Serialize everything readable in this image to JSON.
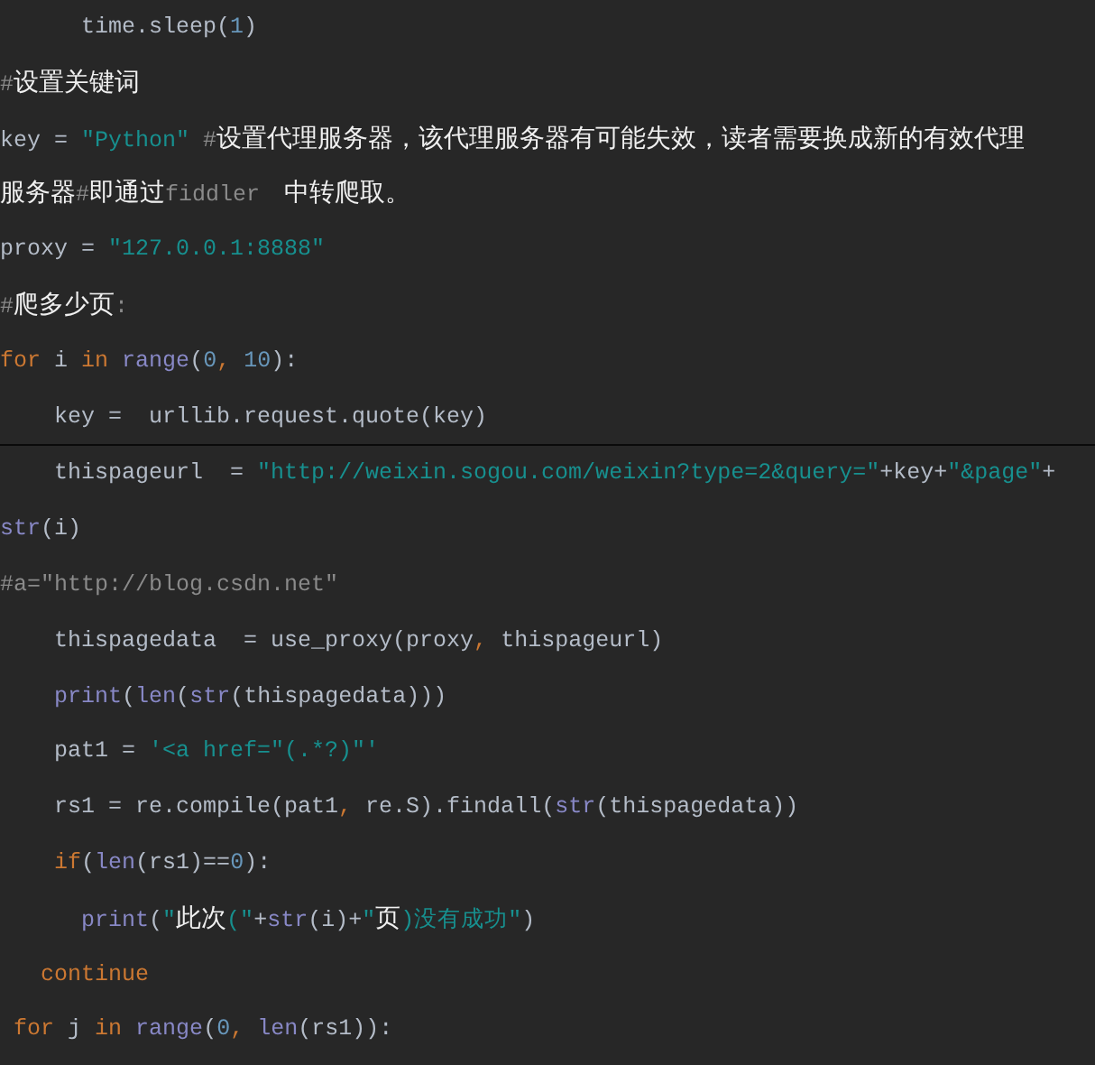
{
  "code_blocks": [
    {
      "lines": [
        {
          "tokens": [
            {
              "kind": "plain",
              "text": "      time.sleep("
            },
            {
              "kind": "number",
              "text": "1"
            },
            {
              "kind": "plain",
              "text": ")"
            }
          ]
        },
        {
          "tokens": [
            {
              "kind": "comment",
              "text": "#"
            },
            {
              "kind": "cjk",
              "text": "设置关键词"
            }
          ]
        },
        {
          "tokens": [
            {
              "kind": "plain",
              "text": "key = "
            },
            {
              "kind": "string",
              "text": "\"Python\" "
            },
            {
              "kind": "comment",
              "text": "#"
            },
            {
              "kind": "cjk",
              "text": "设置代理服务器，该代理服务器有可能失效，读者需要换成新的有效代理"
            }
          ]
        },
        {
          "tokens": [
            {
              "kind": "cjk",
              "text": "服务器"
            },
            {
              "kind": "comment",
              "text": "#"
            },
            {
              "kind": "cjk",
              "text": "即通过"
            },
            {
              "kind": "comment",
              "text": "fiddler"
            },
            {
              "kind": "cjk",
              "text": "   中转爬取。"
            }
          ]
        },
        {
          "tokens": [
            {
              "kind": "plain",
              "text": "proxy = "
            },
            {
              "kind": "string",
              "text": "\"127.0.0.1:8888\""
            }
          ]
        },
        {
          "tokens": [
            {
              "kind": "comment",
              "text": "#"
            },
            {
              "kind": "cjk",
              "text": "爬多少页"
            },
            {
              "kind": "comment",
              "text": ":"
            }
          ]
        },
        {
          "tokens": [
            {
              "kind": "keyword",
              "text": "for"
            },
            {
              "kind": "plain",
              "text": " i "
            },
            {
              "kind": "keyword",
              "text": "in "
            },
            {
              "kind": "builtin",
              "text": "range"
            },
            {
              "kind": "plain",
              "text": "("
            },
            {
              "kind": "number",
              "text": "0"
            },
            {
              "kind": "keyword",
              "text": ", "
            },
            {
              "kind": "number",
              "text": "10"
            },
            {
              "kind": "plain",
              "text": "):"
            }
          ]
        },
        {
          "tokens": [
            {
              "kind": "plain",
              "text": "    key =  urllib.request.quote(key)"
            }
          ]
        }
      ]
    },
    {
      "lines": [
        {
          "tokens": [
            {
              "kind": "plain",
              "text": "    thispageurl  = "
            },
            {
              "kind": "string",
              "text": "\"http://weixin.sogou.com/weixin?type=2&query=\""
            },
            {
              "kind": "plain",
              "text": "+key+"
            },
            {
              "kind": "string",
              "text": "\"&page\""
            },
            {
              "kind": "plain",
              "text": "+"
            }
          ]
        },
        {
          "tokens": [
            {
              "kind": "builtin",
              "text": "str"
            },
            {
              "kind": "plain",
              "text": "(i)"
            }
          ]
        },
        {
          "tokens": [
            {
              "kind": "comment",
              "text": "#a=\"http://blog.csdn.net\""
            }
          ]
        },
        {
          "tokens": [
            {
              "kind": "plain",
              "text": "    thispagedata  = use_proxy(proxy"
            },
            {
              "kind": "keyword",
              "text": ","
            },
            {
              "kind": "plain",
              "text": " thispageurl)"
            }
          ]
        },
        {
          "tokens": [
            {
              "kind": "builtin",
              "text": "    print"
            },
            {
              "kind": "plain",
              "text": "("
            },
            {
              "kind": "builtin",
              "text": "len"
            },
            {
              "kind": "plain",
              "text": "("
            },
            {
              "kind": "builtin",
              "text": "str"
            },
            {
              "kind": "plain",
              "text": "(thispagedata)))"
            }
          ]
        },
        {
          "tokens": [
            {
              "kind": "plain",
              "text": "    pat1 = "
            },
            {
              "kind": "string",
              "text": "'<a href=\"(.*?)\"'"
            }
          ]
        },
        {
          "tokens": [
            {
              "kind": "plain",
              "text": "    rs1 = re.compile(pat1"
            },
            {
              "kind": "keyword",
              "text": ","
            },
            {
              "kind": "plain",
              "text": " re.S).findall("
            },
            {
              "kind": "builtin",
              "text": "str"
            },
            {
              "kind": "plain",
              "text": "(thispagedata))"
            }
          ]
        },
        {
          "tokens": [
            {
              "kind": "keyword",
              "text": "    if"
            },
            {
              "kind": "plain",
              "text": "("
            },
            {
              "kind": "builtin",
              "text": "len"
            },
            {
              "kind": "plain",
              "text": "(rs1)=="
            },
            {
              "kind": "number",
              "text": "0"
            },
            {
              "kind": "plain",
              "text": "):"
            }
          ]
        },
        {
          "tokens": [
            {
              "kind": "builtin",
              "text": "      print"
            },
            {
              "kind": "plain",
              "text": "("
            },
            {
              "kind": "string",
              "text": "\""
            },
            {
              "kind": "cjk",
              "text": "此次"
            },
            {
              "kind": "string",
              "text": "(\""
            },
            {
              "kind": "plain",
              "text": "+"
            },
            {
              "kind": "builtin",
              "text": "str"
            },
            {
              "kind": "plain",
              "text": "(i)+"
            },
            {
              "kind": "string",
              "text": "\""
            },
            {
              "kind": "cjk",
              "text": "页"
            },
            {
              "kind": "string",
              "text": ")没有成功\""
            },
            {
              "kind": "plain",
              "text": ")"
            }
          ]
        },
        {
          "tokens": [
            {
              "kind": "keyword",
              "text": "   continue"
            }
          ]
        },
        {
          "tokens": [
            {
              "kind": "keyword",
              "text": " for"
            },
            {
              "kind": "plain",
              "text": " j "
            },
            {
              "kind": "keyword",
              "text": "in "
            },
            {
              "kind": "builtin",
              "text": "range"
            },
            {
              "kind": "plain",
              "text": "("
            },
            {
              "kind": "number",
              "text": "0"
            },
            {
              "kind": "keyword",
              "text": ", "
            },
            {
              "kind": "builtin",
              "text": "len"
            },
            {
              "kind": "plain",
              "text": "(rs1)):"
            }
          ]
        }
      ]
    }
  ]
}
